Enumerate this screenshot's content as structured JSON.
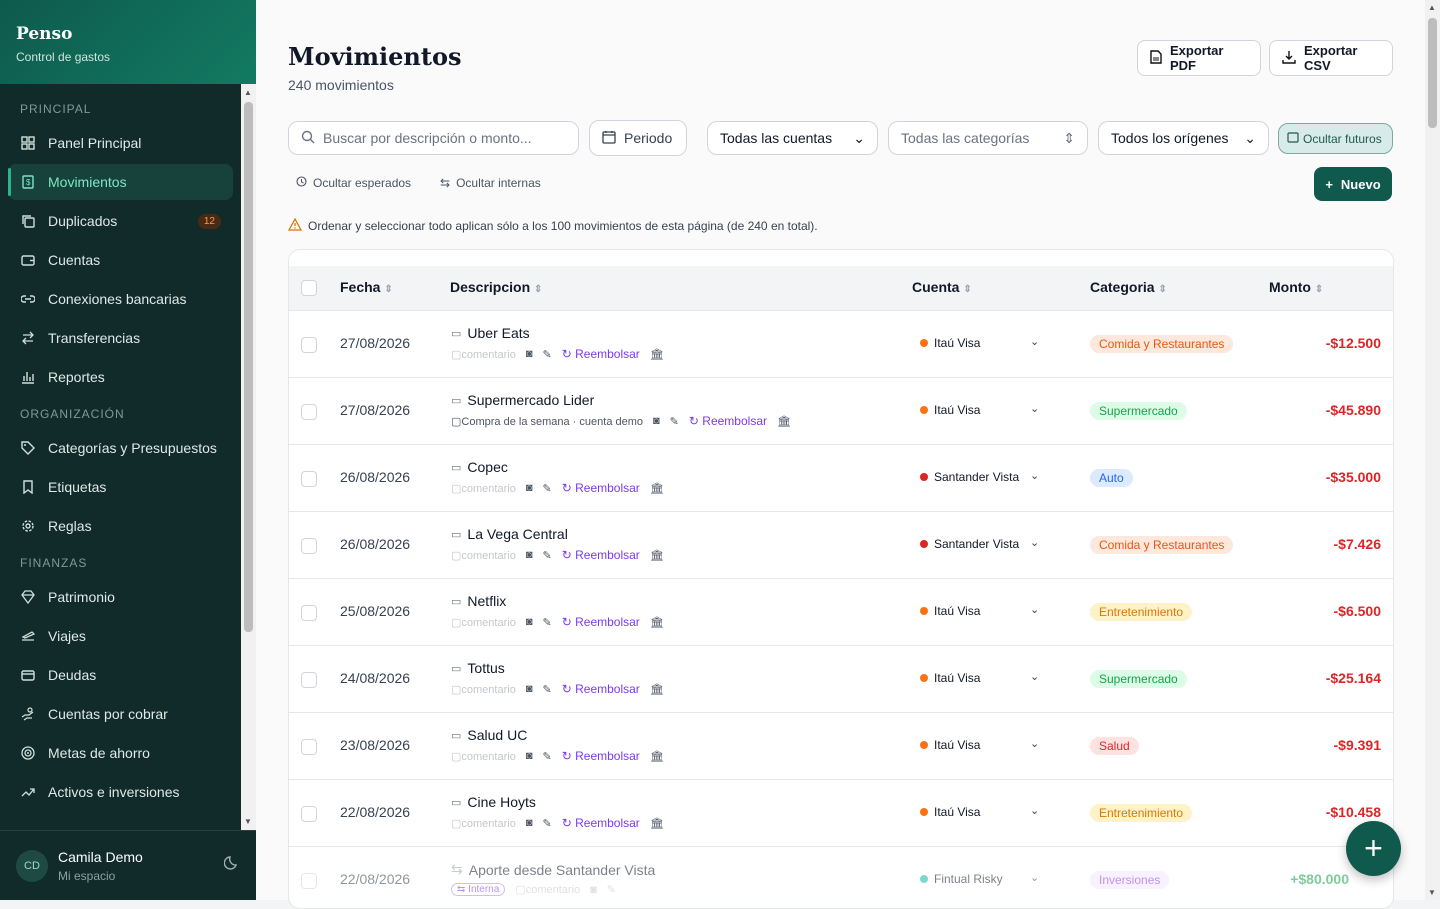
{
  "brand": {
    "title": "Penso",
    "subtitle": "Control de gastos"
  },
  "nav": {
    "sec_principal": "PRINCIPAL",
    "sec_org": "ORGANIZACIÓN",
    "sec_fin": "FINANZAS",
    "items": [
      {
        "label": "Panel Principal",
        "icon": "grid-icon"
      },
      {
        "label": "Movimientos",
        "icon": "receipt-icon"
      },
      {
        "label": "Duplicados",
        "icon": "copy-icon",
        "badge": "12"
      },
      {
        "label": "Cuentas",
        "icon": "wallet-icon"
      },
      {
        "label": "Conexiones bancarias",
        "icon": "link-icon"
      },
      {
        "label": "Transferencias",
        "icon": "arrows-icon"
      },
      {
        "label": "Reportes",
        "icon": "bar-chart-icon"
      },
      {
        "label": "Categorías y Presupuestos",
        "icon": "tag-icon"
      },
      {
        "label": "Etiquetas",
        "icon": "bookmark-icon"
      },
      {
        "label": "Reglas",
        "icon": "gear-icon"
      },
      {
        "label": "Patrimonio",
        "icon": "diamond-icon"
      },
      {
        "label": "Viajes",
        "icon": "plane-icon"
      },
      {
        "label": "Deudas",
        "icon": "card-icon"
      },
      {
        "label": "Cuentas por cobrar",
        "icon": "hand-icon"
      },
      {
        "label": "Metas de ahorro",
        "icon": "target-icon"
      },
      {
        "label": "Activos e inversiones",
        "icon": "trend-icon"
      }
    ]
  },
  "user": {
    "initials": "CD",
    "name": "Camila Demo",
    "space": "Mi espacio"
  },
  "header": {
    "title": "Movimientos",
    "count": "240 movimientos",
    "export_pdf": "Exportar PDF",
    "export_csv": "Exportar CSV"
  },
  "filters": {
    "search_placeholder": "Buscar por descripción o monto...",
    "period": "Periodo",
    "accounts": "Todas las cuentas",
    "categories": "Todas las categorías",
    "origins": "Todos los orígenes",
    "hide_future": "Ocultar futuros",
    "hide_expected": "Ocultar esperados",
    "hide_internal": "Ocultar internas",
    "new": "Nuevo"
  },
  "warning": "Ordenar y seleccionar todo aplican sólo a los 100 movimientos de esta página (de 240 en total).",
  "table": {
    "headers": {
      "date": "Fecha",
      "desc": "Descripcion",
      "account": "Cuenta",
      "category": "Categoria",
      "amount": "Monto"
    },
    "rows": [
      {
        "date": "27/08/2026",
        "desc": "Uber Eats",
        "comment": "comentario",
        "refund": "Reembolsar",
        "account": "Itaú Visa",
        "acct_color": "#f97316",
        "category": "Comida y Restaurantes",
        "cat_bg": "#fde8dd",
        "cat_fg": "#ea580c",
        "amount": "-$12.500",
        "amt_color": "#dc2626"
      },
      {
        "date": "27/08/2026",
        "desc": "Supermercado Lider",
        "comment": "Compra de la semana · cuenta demo",
        "refund": "Reembolsar",
        "account": "Itaú Visa",
        "acct_color": "#f97316",
        "category": "Supermercado",
        "cat_bg": "#dcfce7",
        "cat_fg": "#16a34a",
        "amount": "-$45.890",
        "amt_color": "#dc2626"
      },
      {
        "date": "26/08/2026",
        "desc": "Copec",
        "comment": "comentario",
        "refund": "Reembolsar",
        "account": "Santander Vista",
        "acct_color": "#dc2626",
        "category": "Auto",
        "cat_bg": "#dbeafe",
        "cat_fg": "#2563eb",
        "amount": "-$35.000",
        "amt_color": "#dc2626"
      },
      {
        "date": "26/08/2026",
        "desc": "La Vega Central",
        "comment": "comentario",
        "refund": "Reembolsar",
        "account": "Santander Vista",
        "acct_color": "#dc2626",
        "category": "Comida y Restaurantes",
        "cat_bg": "#fde8dd",
        "cat_fg": "#ea580c",
        "amount": "-$7.426",
        "amt_color": "#dc2626"
      },
      {
        "date": "25/08/2026",
        "desc": "Netflix",
        "comment": "comentario",
        "refund": "Reembolsar",
        "account": "Itaú Visa",
        "acct_color": "#f97316",
        "category": "Entretenimiento",
        "cat_bg": "#fef3c7",
        "cat_fg": "#d97706",
        "amount": "-$6.500",
        "amt_color": "#dc2626"
      },
      {
        "date": "24/08/2026",
        "desc": "Tottus",
        "comment": "comentario",
        "refund": "Reembolsar",
        "account": "Itaú Visa",
        "acct_color": "#f97316",
        "category": "Supermercado",
        "cat_bg": "#dcfce7",
        "cat_fg": "#16a34a",
        "amount": "-$25.164",
        "amt_color": "#dc2626"
      },
      {
        "date": "23/08/2026",
        "desc": "Salud UC",
        "comment": "comentario",
        "refund": "Reembolsar",
        "account": "Itaú Visa",
        "acct_color": "#f97316",
        "category": "Salud",
        "cat_bg": "#fee2e2",
        "cat_fg": "#dc2626",
        "amount": "-$9.391",
        "amt_color": "#dc2626"
      },
      {
        "date": "22/08/2026",
        "desc": "Cine Hoyts",
        "comment": "comentario",
        "refund": "Reembolsar",
        "account": "Itaú Visa",
        "acct_color": "#f97316",
        "category": "Entretenimiento",
        "cat_bg": "#fef3c7",
        "cat_fg": "#d97706",
        "amount": "-$10.458",
        "amt_color": "#dc2626"
      }
    ],
    "internal_row": {
      "date": "22/08/2026",
      "desc": "Aporte desde Santander Vista",
      "tag": "Interna",
      "comment": "comentario",
      "account": "Fintual Risky",
      "acct_color": "#14b8a6",
      "category": "Inversiones",
      "cat_bg": "#f3e8ff",
      "cat_fg": "#9333ea",
      "amount": "+$80.000",
      "amt_color": "#16a34a"
    }
  }
}
